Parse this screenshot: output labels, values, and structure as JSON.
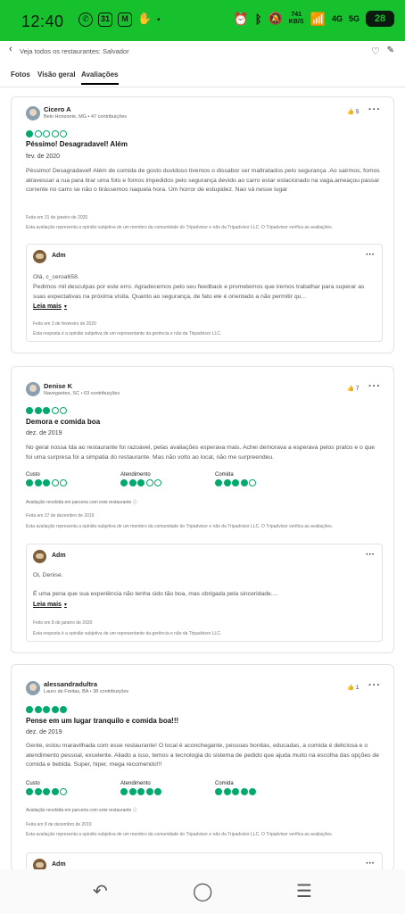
{
  "status": {
    "time": "12:40",
    "network_speed": "741",
    "network_unit": "KB/S",
    "signal1": "4G",
    "signal2": "5G",
    "battery": "28"
  },
  "header": {
    "back_label": "Veja todos os restaurantes: Salvador"
  },
  "tabs": [
    "Fotos",
    "Visão geral",
    "Avaliações"
  ],
  "reviews": [
    {
      "user": "Cicero A",
      "location": "Belo Horizonte, MG • 47 contribuições",
      "likes": "5",
      "rating": 1,
      "title": "Péssimo! Desagradavel! Além",
      "date": "fev. de 2020",
      "body": "Péssimo! Desagradavel! Além de comida de gosto duvidoso tivemos o dissabor ser maltratados pelo segurança .Ao sairmos, fomos atravessar a rua para tirar uma foto e fomos impedidos pelo segurança devido ao carro estar estacionado na vaga,ameaçou passar corrente no carro se não o tirássemos naquela hora. Um horror de estupidez. Nao vá nesse lugar",
      "written": "Feita em 31 de janeiro de 2020",
      "disclaimer": "Esta avaliação representa a opinião subjetiva de um membro da comunidade do Tripadvisor e não da Tripadvisor LLC. O Tripadvisor verifica as avaliações.",
      "response": {
        "name": "Adm",
        "greeting": "Olá, c_ceroa658.",
        "text": "Pedimos mil desculpas por este erro. Agradecemos pelo seu feedback e prometemos que iremos trabalhar para superar as suas expectativas na próxima visita. Quanto ao segurança, de fato ele é orientado a não permitir qu...",
        "read_more": "Leia mais",
        "date": "Feito em 3 de fevereiro de 2020",
        "disclaimer": "Esta resposta é a opinião subjetiva de um representante da gerência e não da Tripadvisor LLC."
      }
    },
    {
      "user": "Denise K",
      "location": "Navegantes, SC • 63 contribuições",
      "likes": "7",
      "rating": 3,
      "title": "Demora e comida boa",
      "date": "dez. de 2019",
      "body": "No geral nossa Ida ao restaurante foi razoável, pelas avaliações esperava mais. Achei demorava a esperava pelos pratos e o que foi uma surpresa foi a simpatia do restaurante. Mas não volto ao local, não me surpreendeu.",
      "subratings": [
        {
          "label": "Custo",
          "value": 3
        },
        {
          "label": "Atendimento",
          "value": 3
        },
        {
          "label": "Comida",
          "value": 4
        }
      ],
      "partner": "Avaliação recebida em parceria com este restaurante ⓘ",
      "written": "Feita em 27 de dezembro de 2019",
      "disclaimer": "Esta avaliação representa a opinião subjetiva de um membro da comunidade do Tripadvisor e não da Tripadvisor LLC. O Tripadvisor verifica as avaliações.",
      "response": {
        "name": "Adm",
        "greeting": "Oi, Denise.",
        "text": "É uma pena que sua experiência não tenha sido tão boa, mas obrigada pela sinceridade....",
        "read_more": "Leia mais",
        "date": "Feito em 8 de janeiro de 2020",
        "disclaimer": "Esta resposta é a opinião subjetiva de um representante da gerência e não da Tripadvisor LLC."
      }
    },
    {
      "user": "alessandradultra",
      "location": "Lauro de Freitas, BA • 38 contribuições",
      "likes": "1",
      "rating": 5,
      "title": "Pense em um lugar tranquilo e comida boa!!!",
      "date": "dez. de 2019",
      "body": "Gente, estou maravilhada com esse restaurante! O local é aconchegante, pessoas bonitas, educadas, a comida é deliciosa e o atendimento pessoal, excelente. Aliado a isso, temos a tecnologia do sistema de pedido que ajuda muito na escolha das opções de comida e bebida. Super, hiper, mega recomendo!!!",
      "subratings": [
        {
          "label": "Custo",
          "value": 4
        },
        {
          "label": "Atendimento",
          "value": 5
        },
        {
          "label": "Comida",
          "value": 5
        }
      ],
      "partner": "Avaliação recebida em parceria com este restaurante ⓘ",
      "written": "Feita em 8 de dezembro de 2019",
      "disclaimer": "Esta avaliação representa a opinião subjetiva de um membro da comunidade do Tripadvisor e não da Tripadvisor LLC. O Tripadvisor verifica as avaliações.",
      "response": {
        "name": "Adm"
      }
    }
  ],
  "icons": {
    "back": "chevron-left-icon",
    "favorite": "heart-icon",
    "edit": "pencil-icon",
    "like": "thumbs-up-icon",
    "more": "more-icon"
  },
  "colors": {
    "status_bar": "#17c12e",
    "bubble": "#00aa6c"
  }
}
